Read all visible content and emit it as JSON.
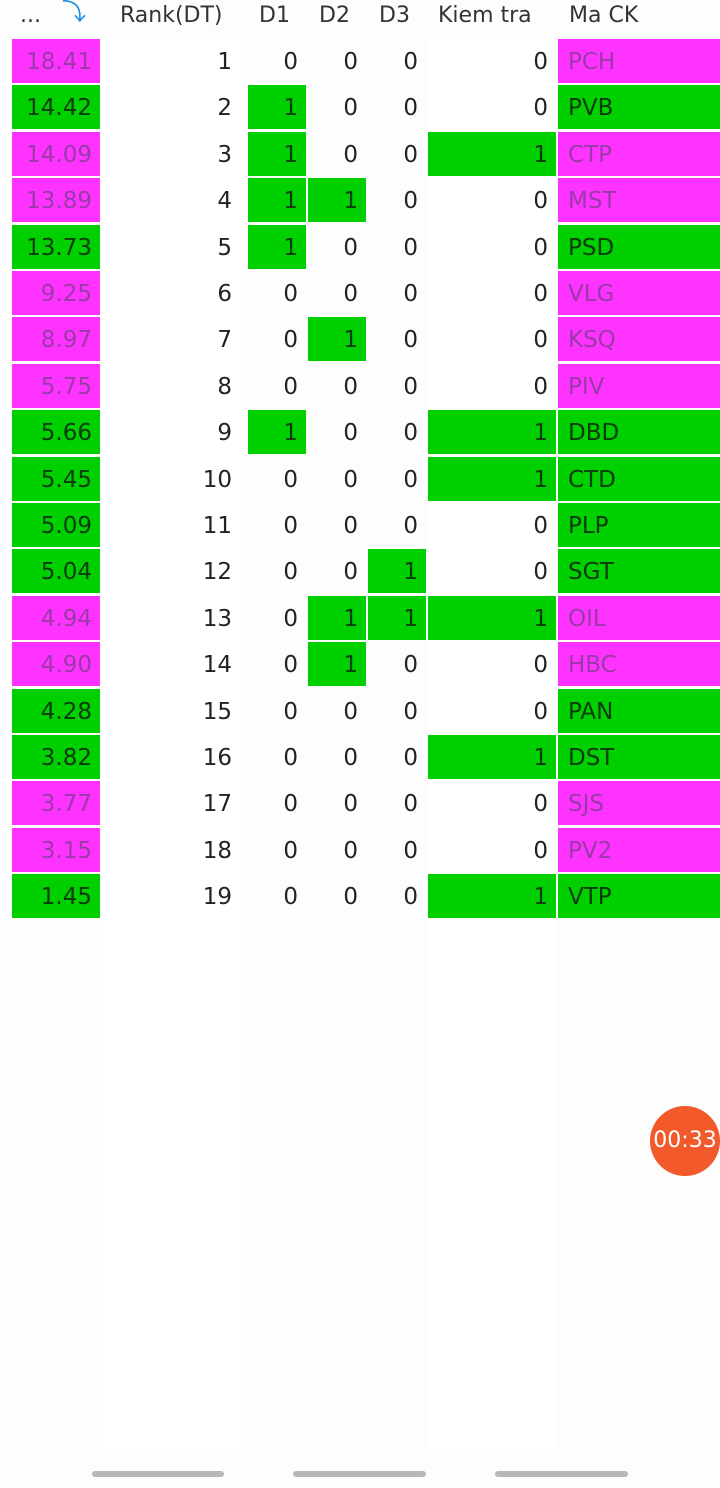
{
  "header": {
    "col0": "...",
    "col0_icon": "sort-arrow-icon",
    "rank": "Rank(DT)",
    "d1": "D1",
    "d2": "D2",
    "d3": "D3",
    "kiem_tra": "Kiem tra",
    "ma_ck": "Ma CK"
  },
  "colors": {
    "magenta": "#ff33ff",
    "green": "#00d000"
  },
  "rows": [
    {
      "value": "18.41",
      "rank": "1",
      "d1": "0",
      "d2": "0",
      "d3": "0",
      "kiem_tra": "0",
      "ma_ck": "PCH",
      "color": "magenta"
    },
    {
      "value": "14.42",
      "rank": "2",
      "d1": "1",
      "d2": "0",
      "d3": "0",
      "kiem_tra": "0",
      "ma_ck": "PVB",
      "color": "green"
    },
    {
      "value": "14.09",
      "rank": "3",
      "d1": "1",
      "d2": "0",
      "d3": "0",
      "kiem_tra": "1",
      "ma_ck": "CTP",
      "color": "magenta"
    },
    {
      "value": "13.89",
      "rank": "4",
      "d1": "1",
      "d2": "1",
      "d3": "0",
      "kiem_tra": "0",
      "ma_ck": "MST",
      "color": "magenta"
    },
    {
      "value": "13.73",
      "rank": "5",
      "d1": "1",
      "d2": "0",
      "d3": "0",
      "kiem_tra": "0",
      "ma_ck": "PSD",
      "color": "green"
    },
    {
      "value": "9.25",
      "rank": "6",
      "d1": "0",
      "d2": "0",
      "d3": "0",
      "kiem_tra": "0",
      "ma_ck": "VLG",
      "color": "magenta"
    },
    {
      "value": "8.97",
      "rank": "7",
      "d1": "0",
      "d2": "1",
      "d3": "0",
      "kiem_tra": "0",
      "ma_ck": "KSQ",
      "color": "magenta"
    },
    {
      "value": "5.75",
      "rank": "8",
      "d1": "0",
      "d2": "0",
      "d3": "0",
      "kiem_tra": "0",
      "ma_ck": "PIV",
      "color": "magenta"
    },
    {
      "value": "5.66",
      "rank": "9",
      "d1": "1",
      "d2": "0",
      "d3": "0",
      "kiem_tra": "1",
      "ma_ck": "DBD",
      "color": "green"
    },
    {
      "value": "5.45",
      "rank": "10",
      "d1": "0",
      "d2": "0",
      "d3": "0",
      "kiem_tra": "1",
      "ma_ck": "CTD",
      "color": "green"
    },
    {
      "value": "5.09",
      "rank": "11",
      "d1": "0",
      "d2": "0",
      "d3": "0",
      "kiem_tra": "0",
      "ma_ck": "PLP",
      "color": "green"
    },
    {
      "value": "5.04",
      "rank": "12",
      "d1": "0",
      "d2": "0",
      "d3": "1",
      "kiem_tra": "0",
      "ma_ck": "SGT",
      "color": "green"
    },
    {
      "value": "4.94",
      "rank": "13",
      "d1": "0",
      "d2": "1",
      "d3": "1",
      "kiem_tra": "1",
      "ma_ck": "OIL",
      "color": "magenta"
    },
    {
      "value": "4.90",
      "rank": "14",
      "d1": "0",
      "d2": "1",
      "d3": "0",
      "kiem_tra": "0",
      "ma_ck": "HBC",
      "color": "magenta"
    },
    {
      "value": "4.28",
      "rank": "15",
      "d1": "0",
      "d2": "0",
      "d3": "0",
      "kiem_tra": "0",
      "ma_ck": "PAN",
      "color": "green"
    },
    {
      "value": "3.82",
      "rank": "16",
      "d1": "0",
      "d2": "0",
      "d3": "0",
      "kiem_tra": "1",
      "ma_ck": "DST",
      "color": "green"
    },
    {
      "value": "3.77",
      "rank": "17",
      "d1": "0",
      "d2": "0",
      "d3": "0",
      "kiem_tra": "0",
      "ma_ck": "SJS",
      "color": "magenta"
    },
    {
      "value": "3.15",
      "rank": "18",
      "d1": "0",
      "d2": "0",
      "d3": "0",
      "kiem_tra": "0",
      "ma_ck": "PV2",
      "color": "magenta"
    },
    {
      "value": "1.45",
      "rank": "19",
      "d1": "0",
      "d2": "0",
      "d3": "0",
      "kiem_tra": "1",
      "ma_ck": "VTP",
      "color": "green"
    }
  ],
  "timer": "00:33"
}
